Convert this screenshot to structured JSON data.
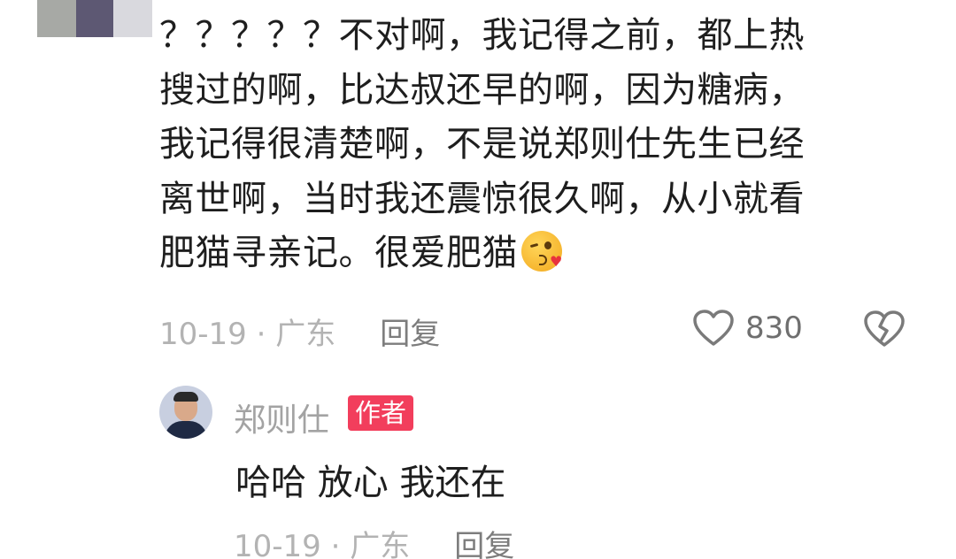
{
  "comment": {
    "lines": [
      "？？？？？不对啊，我记得之前，都上热",
      "搜过的啊，比达叔还早的啊，因为糖病，",
      "我记得很清楚啊，不是说郑则仕先生已经",
      "离世啊，当时我还震惊很久啊，从小就看",
      "肥猫寻亲记。很爱肥猫"
    ],
    "emoji": "kissing-wink-heart-emoji",
    "date": "10-19 · 广东",
    "reply_label": "回复",
    "like_count": "830"
  },
  "reply": {
    "author": "郑则仕",
    "badge": "作者",
    "text": "哈哈 放心 我还在",
    "date": "10-19 · 广东",
    "reply_label": "回复"
  },
  "colors": {
    "badge": "#f23e5c",
    "text": "#1e1e1e",
    "meta": "#b3b3b3"
  }
}
